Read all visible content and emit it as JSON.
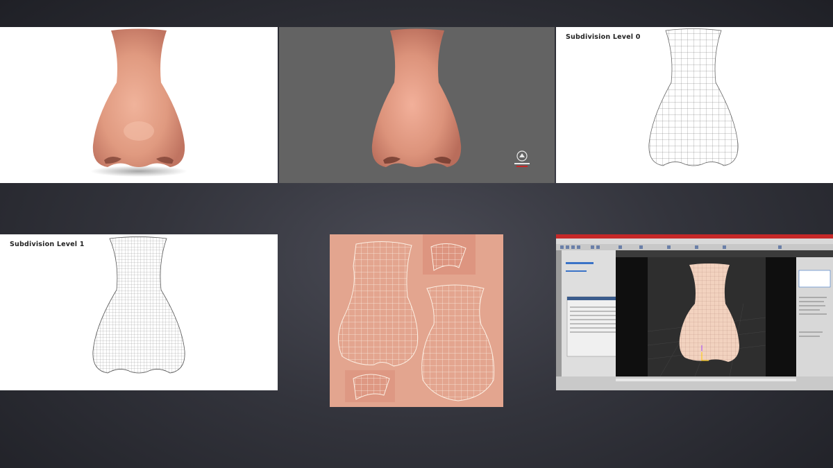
{
  "panels": {
    "render_white": {},
    "render_gray": {},
    "wireframe_level0": {
      "label": "Subdivision Level 0"
    },
    "wireframe_level1": {
      "label": "Subdivision Level 1"
    },
    "uv_texture_map": {},
    "software_screenshot": {}
  },
  "colors": {
    "background": "#33343c",
    "skin": "#e6a48c",
    "gray_backdrop": "#636363",
    "uv_background": "#e3a58f",
    "wire": "#555555",
    "uv_wire": "#fdf0e4",
    "app_titlebar": "#c62828"
  }
}
